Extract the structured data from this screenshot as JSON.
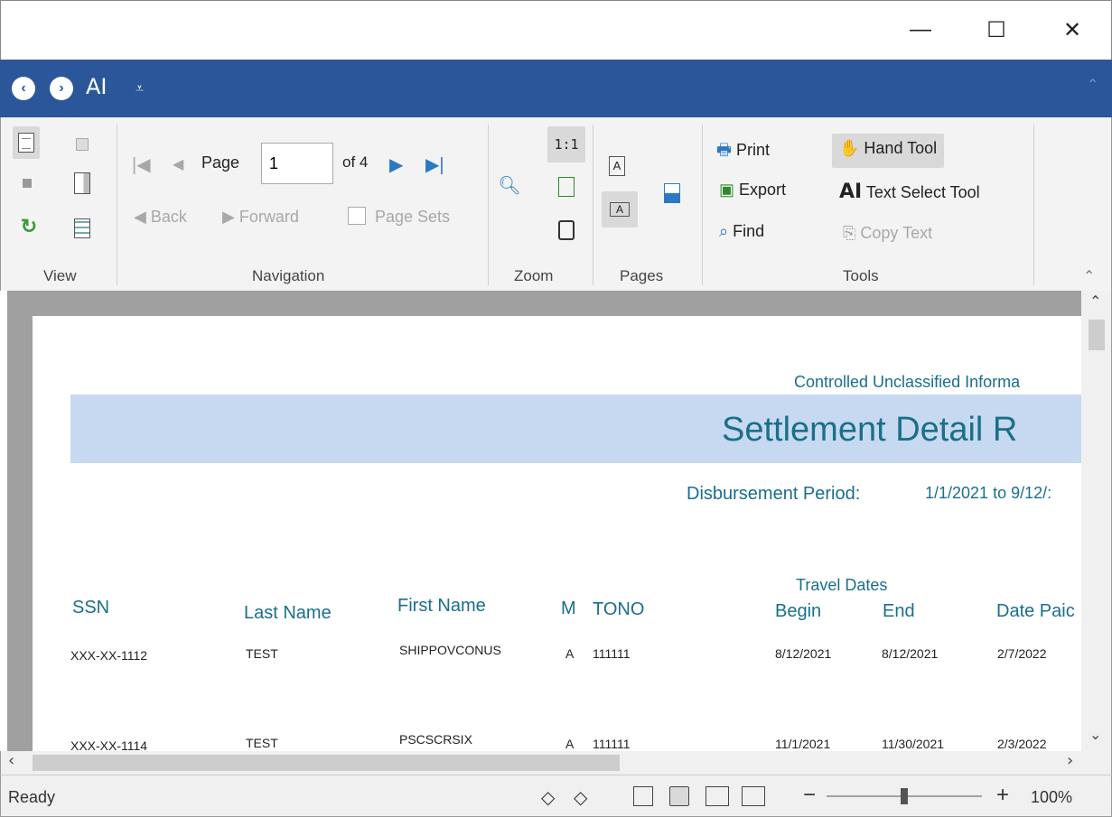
{
  "window": {
    "minimize_glyph": "—",
    "maximize_glyph": "☐",
    "close_glyph": "✕"
  },
  "quick_access": {
    "back_icon": "back-circle-icon",
    "forward_icon": "forward-circle-icon",
    "text_select_label": "AI",
    "customize_glyph": "⩡"
  },
  "ribbon": {
    "view": {
      "label": "View"
    },
    "navigation": {
      "label": "Navigation",
      "page_label": "Page",
      "page_value": "1",
      "of_label": "of 4",
      "back_label": "Back",
      "forward_label": "Forward",
      "page_sets_label": "Page Sets"
    },
    "zoom": {
      "label": "Zoom",
      "one_to_one": "1:1"
    },
    "pages": {
      "label": "Pages"
    },
    "tools": {
      "label": "Tools",
      "print_label": "Print",
      "export_label": "Export",
      "find_label": "Find",
      "hand_tool_label": "Hand Tool",
      "text_select_label": "Text Select Tool",
      "text_select_glyph": "AI",
      "copy_text_label": "Copy Text"
    }
  },
  "report": {
    "classification": "Controlled Unclassified Informa",
    "title": "Settlement Detail R",
    "period_label": "Disbursement Period:",
    "period_value": "1/1/2021 to 9/12/:",
    "travel_dates_label": "Travel Dates",
    "columns": [
      "SSN",
      "Last Name",
      "First Name",
      "M",
      "TONO",
      "Begin",
      "End",
      "Date Paic"
    ],
    "rows": [
      [
        "XXX-XX-1112",
        "TEST",
        "SHIPPOVCONUS",
        "A",
        "111111",
        "8/12/2021",
        "8/12/2021",
        "2/7/2022"
      ],
      [
        "XXX-XX-1114",
        "TEST",
        "PSCSCRSIX",
        "A",
        "111111",
        "11/1/2021",
        "11/30/2021",
        "2/3/2022"
      ]
    ]
  },
  "statusbar": {
    "status": "Ready",
    "zoom_percent": "100%",
    "zoom_minus": "−",
    "zoom_plus": "+",
    "zoom_level": 0.5
  }
}
